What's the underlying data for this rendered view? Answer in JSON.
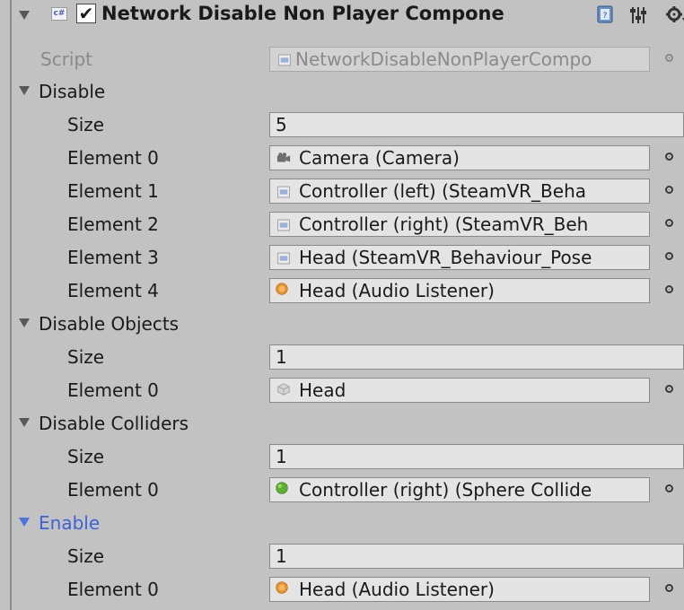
{
  "component": {
    "title": "Network Disable Non Player Compone",
    "enabled": true,
    "script_label": "Script",
    "script_value": "NetworkDisableNonPlayerCompo",
    "cs_badge": "c#"
  },
  "disable": {
    "label": "Disable",
    "size_label": "Size",
    "size": "5",
    "elements": [
      {
        "label": "Element 0",
        "value": "Camera (Camera)",
        "icon": "camera-icon"
      },
      {
        "label": "Element 1",
        "value": "Controller (left) (SteamVR_Beha",
        "icon": "script-icon"
      },
      {
        "label": "Element 2",
        "value": "Controller (right) (SteamVR_Beh",
        "icon": "script-icon"
      },
      {
        "label": "Element 3",
        "value": "Head (SteamVR_Behaviour_Pose",
        "icon": "script-icon"
      },
      {
        "label": "Element 4",
        "value": "Head (Audio Listener)",
        "icon": "audio-listener-icon"
      }
    ]
  },
  "disable_objects": {
    "label": "Disable Objects",
    "size_label": "Size",
    "size": "1",
    "elements": [
      {
        "label": "Element 0",
        "value": "Head",
        "icon": "gameobject-cube-icon"
      }
    ]
  },
  "disable_colliders": {
    "label": "Disable Colliders",
    "size_label": "Size",
    "size": "1",
    "elements": [
      {
        "label": "Element 0",
        "value": "Controller (right) (Sphere Collide",
        "icon": "sphere-collider-icon"
      }
    ]
  },
  "enable": {
    "label": "Enable",
    "size_label": "Size",
    "size": "1",
    "elements": [
      {
        "label": "Element 0",
        "value": "Head (Audio Listener)",
        "icon": "audio-listener-icon"
      }
    ]
  },
  "colors": {
    "panel_bg": "#c2c2c2",
    "field_bg": "#e4e4e4",
    "focus_blue": "#4a72e0"
  }
}
